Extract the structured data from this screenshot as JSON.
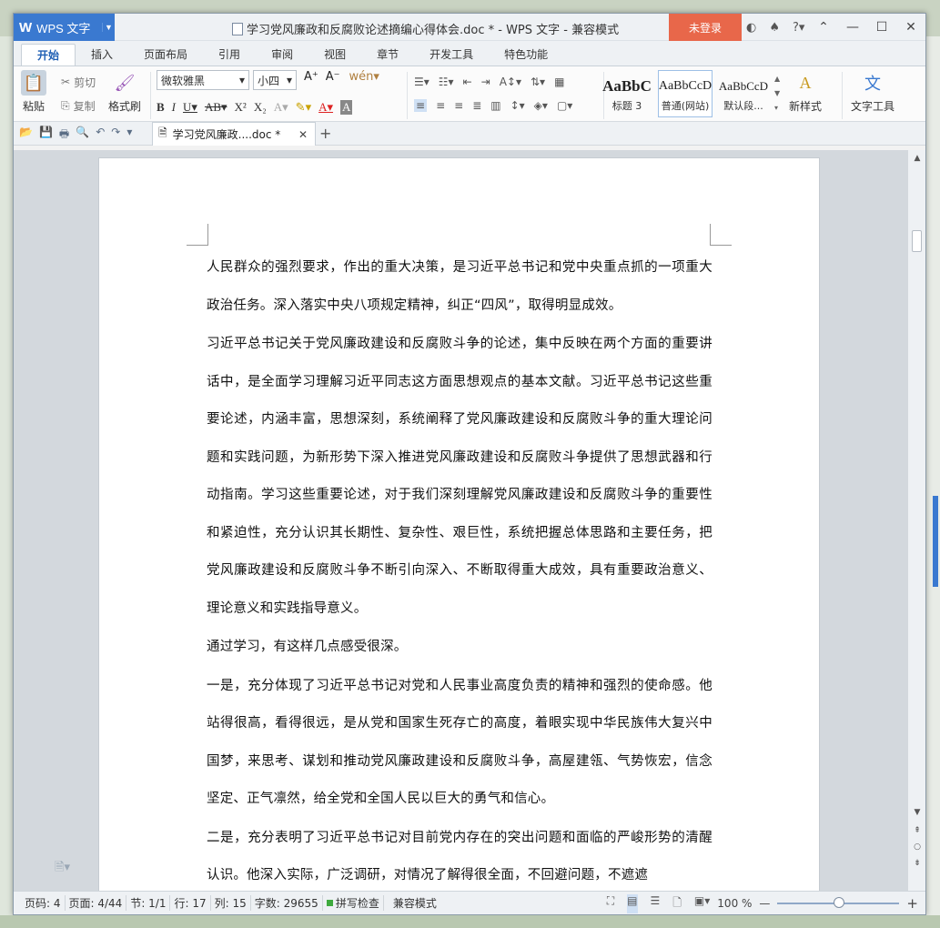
{
  "titlebar": {
    "app_name": "WPS 文字",
    "doc_title": "学习党风廉政和反腐败论述摘编心得体会.doc * - WPS 文字 - 兼容模式",
    "login_label": "未登录"
  },
  "tabs": [
    "开始",
    "插入",
    "页面布局",
    "引用",
    "审阅",
    "视图",
    "章节",
    "开发工具",
    "特色功能"
  ],
  "ribbon": {
    "paste_label": "粘贴",
    "cut_label": "剪切",
    "copy_label": "复制",
    "format_painter_label": "格式刷",
    "font_name": "微软雅黑",
    "font_size": "小四",
    "styles": [
      {
        "preview": "AaBbC",
        "name": "标题 3"
      },
      {
        "preview": "AaBbCcD",
        "name": "普通(网站)"
      },
      {
        "preview": "AaBbCcD",
        "name": "默认段..."
      }
    ],
    "new_style_label": "新样式",
    "text_tools_label": "文字工具"
  },
  "doc_tab": {
    "label": "学习党风廉政....doc *"
  },
  "document": {
    "paragraphs": [
      "人民群众的强烈要求，作出的重大决策，是习近平总书记和党中央重点抓的一项重大政治任务。深入落实中央八项规定精神，纠正“四风”，取得明显成效。",
      "习近平总书记关于党风廉政建设和反腐败斗争的论述，集中反映在两个方面的重要讲话中，是全面学习理解习近平同志这方面思想观点的基本文献。习近平总书记这些重要论述，内涵丰富，思想深刻，系统阐释了党风廉政建设和反腐败斗争的重大理论问题和实践问题，为新形势下深入推进党风廉政建设和反腐败斗争提供了思想武器和行动指南。学习这些重要论述，对于我们深刻理解党风廉政建设和反腐败斗争的重要性和紧迫性，充分认识其长期性、复杂性、艰巨性，系统把握总体思路和主要任务，把党风廉政建设和反腐败斗争不断引向深入、不断取得重大成效，具有重要政治意义、理论意义和实践指导意义。",
      "通过学习，有这样几点感受很深。",
      "一是，充分体现了习近平总书记对党和人民事业高度负责的精神和强烈的使命感。他站得很高，看得很远，是从党和国家生死存亡的高度，着眼实现中华民族伟大复兴中国梦，来思考、谋划和推动党风廉政建设和反腐败斗争，高屋建瓴、气势恢宏，信念坚定、正气凛然，给全党和全国人民以巨大的勇气和信心。",
      "二是，充分表明了习近平总书记对目前党内存在的突出问题和面临的严峻形势的清醒认识。他深入实际，广泛调研，对情况了解得很全面，不回避问题，不遮遮"
    ]
  },
  "statusbar": {
    "page_number": "页码: 4",
    "pages": "页面: 4/44",
    "section": "节: 1/1",
    "line": "行: 17",
    "column": "列: 15",
    "word_count": "字数: 29655",
    "spell_check": "拼写检查",
    "compat_mode": "兼容模式",
    "zoom": "100 %"
  },
  "colors": {
    "accent": "#3a79d0",
    "login": "#e8674a"
  }
}
